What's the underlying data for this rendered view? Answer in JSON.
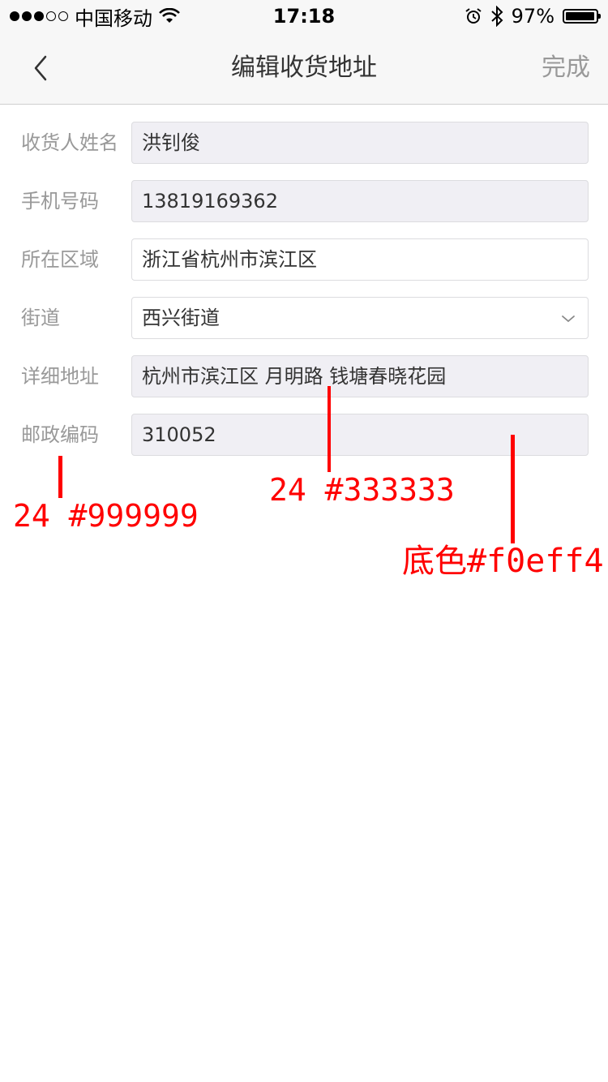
{
  "status_bar": {
    "carrier": "中国移动",
    "time": "17:18",
    "battery": "97%",
    "battery_level": 0.97,
    "signal_bars": 3,
    "signal_total": 5,
    "icons": [
      "wifi-icon",
      "alarm-icon",
      "bluetooth-icon",
      "battery-icon"
    ]
  },
  "nav": {
    "title": "编辑收货地址",
    "done": "完成",
    "back_icon": "chevron-left-icon"
  },
  "form": {
    "rows": [
      {
        "label": "收货人姓名",
        "value": "洪钊俊",
        "style": "filled"
      },
      {
        "label": "手机号码",
        "value": "13819169362",
        "style": "filled"
      },
      {
        "label": "所在区域",
        "value": "浙江省杭州市滨江区",
        "style": "white"
      },
      {
        "label": "街道",
        "value": "西兴街道",
        "style": "white",
        "dropdown": true
      },
      {
        "label": "详细地址",
        "value": "杭州市滨江区 月明路 钱塘春晓花园",
        "style": "filled"
      },
      {
        "label": "邮政编码",
        "value": "310052",
        "style": "filled"
      }
    ]
  },
  "annotations": {
    "label_spec": "24 #999999",
    "value_spec": "24 #333333",
    "bg_spec": "底色#f0eff4"
  },
  "colors": {
    "label": "#999999",
    "value": "#333333",
    "field_bg": "#f0eff4",
    "annotation": "#ff0000",
    "nav_bg": "#f7f7f7"
  }
}
